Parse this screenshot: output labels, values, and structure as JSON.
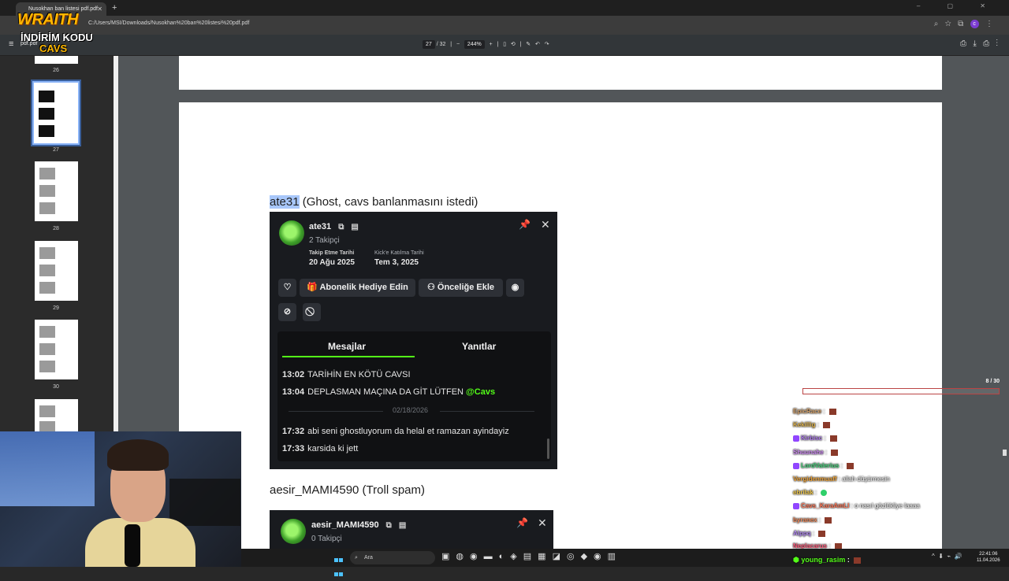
{
  "browser": {
    "tab_title": "Nusokhan ban listesi pdf.pdf",
    "url": "C:/Users/MSI/Downloads/Nusokhan%20ban%20listesi%20pdf.pdf"
  },
  "pdf_toolbar": {
    "doc_title": "pdf.pdf",
    "current_page": "27",
    "total_pages": "/ 32",
    "zoom": "244%"
  },
  "thumbnails": [
    {
      "num": "26"
    },
    {
      "num": "27"
    },
    {
      "num": "28"
    },
    {
      "num": "29"
    },
    {
      "num": "30"
    }
  ],
  "logo": {
    "line1": "WRAITH",
    "line2": "İNDİRİM KODU",
    "line3": "CAVS"
  },
  "document": {
    "heading1_selected": "ate31",
    "heading1_rest": " (Ghost, cavs banlanmasını istedi)",
    "heading2": "aesir_MAMI4590 (Troll spam)"
  },
  "card1": {
    "username": "ate31",
    "followers": "2 Takipçi",
    "follow_date_label": "Takip Etme Tarihi",
    "follow_date": "20 Ağu 2025",
    "join_date_label": "Kick'e Katılma Tarihi",
    "join_date": "Tem 3, 2025",
    "gift_button": "Abonelik Hediye Edin",
    "priority_button": "Önceliğe Ekle",
    "tab_messages": "Mesajlar",
    "tab_replies": "Yanıtlar",
    "messages": [
      {
        "time": "13:02",
        "text": "TARİHİN EN KÖTÜ CAVSI",
        "mention": ""
      },
      {
        "time": "13:04",
        "text": "DEPLASMAN MAÇINA DA GİT LÜTFEN",
        "mention": "@Cavs"
      },
      {
        "time": "17:32",
        "text": "abi seni ghostluyorum da helal et ramazan ayindayiz",
        "mention": ""
      },
      {
        "time": "17:33",
        "text": "karsida ki jett",
        "mention": ""
      }
    ],
    "date_separator": "02/18/2026"
  },
  "card2": {
    "username": "aesir_MAMI4590",
    "followers": "0 Takipçi"
  },
  "chat": {
    "counter": "8 / 30",
    "lines": [
      {
        "user": "EpicRace",
        "color": "#d7a36a",
        "text": "",
        "badge": false
      },
      {
        "user": "Kekillig",
        "color": "#e0b34a",
        "text": "",
        "badge": false
      },
      {
        "user": "Kirbisc",
        "color": "#b07cf0",
        "text": "",
        "badge": true
      },
      {
        "user": "Shuunahe",
        "color": "#d18df7",
        "text": "",
        "badge": false
      },
      {
        "user": "LordValerius",
        "color": "#48d67e",
        "text": "",
        "badge": true
      },
      {
        "user": "Vergidenmuaff",
        "color": "#f0a53a",
        "text": "allah düşürmesin",
        "badge": false
      },
      {
        "user": "ebrilak",
        "color": "#f0c84a",
        "text": "",
        "badge": false
      },
      {
        "user": "Cavs_KaraAmLI",
        "color": "#ff7a5a",
        "text": "o nasıl gözlükliye laaaa",
        "badge": true
      },
      {
        "user": "byranex",
        "color": "#f28a5a",
        "text": "",
        "badge": false
      },
      {
        "user": "Alppq",
        "color": "#b48af5",
        "text": "",
        "badge": false
      },
      {
        "user": "Neplacarus",
        "color": "#ff5a7a",
        "text": "",
        "badge": false
      }
    ],
    "last_user": "young_rasim"
  },
  "taskbar": {
    "search_placeholder": "Ara",
    "time": "22:41:06",
    "date": "11.04.2026"
  }
}
